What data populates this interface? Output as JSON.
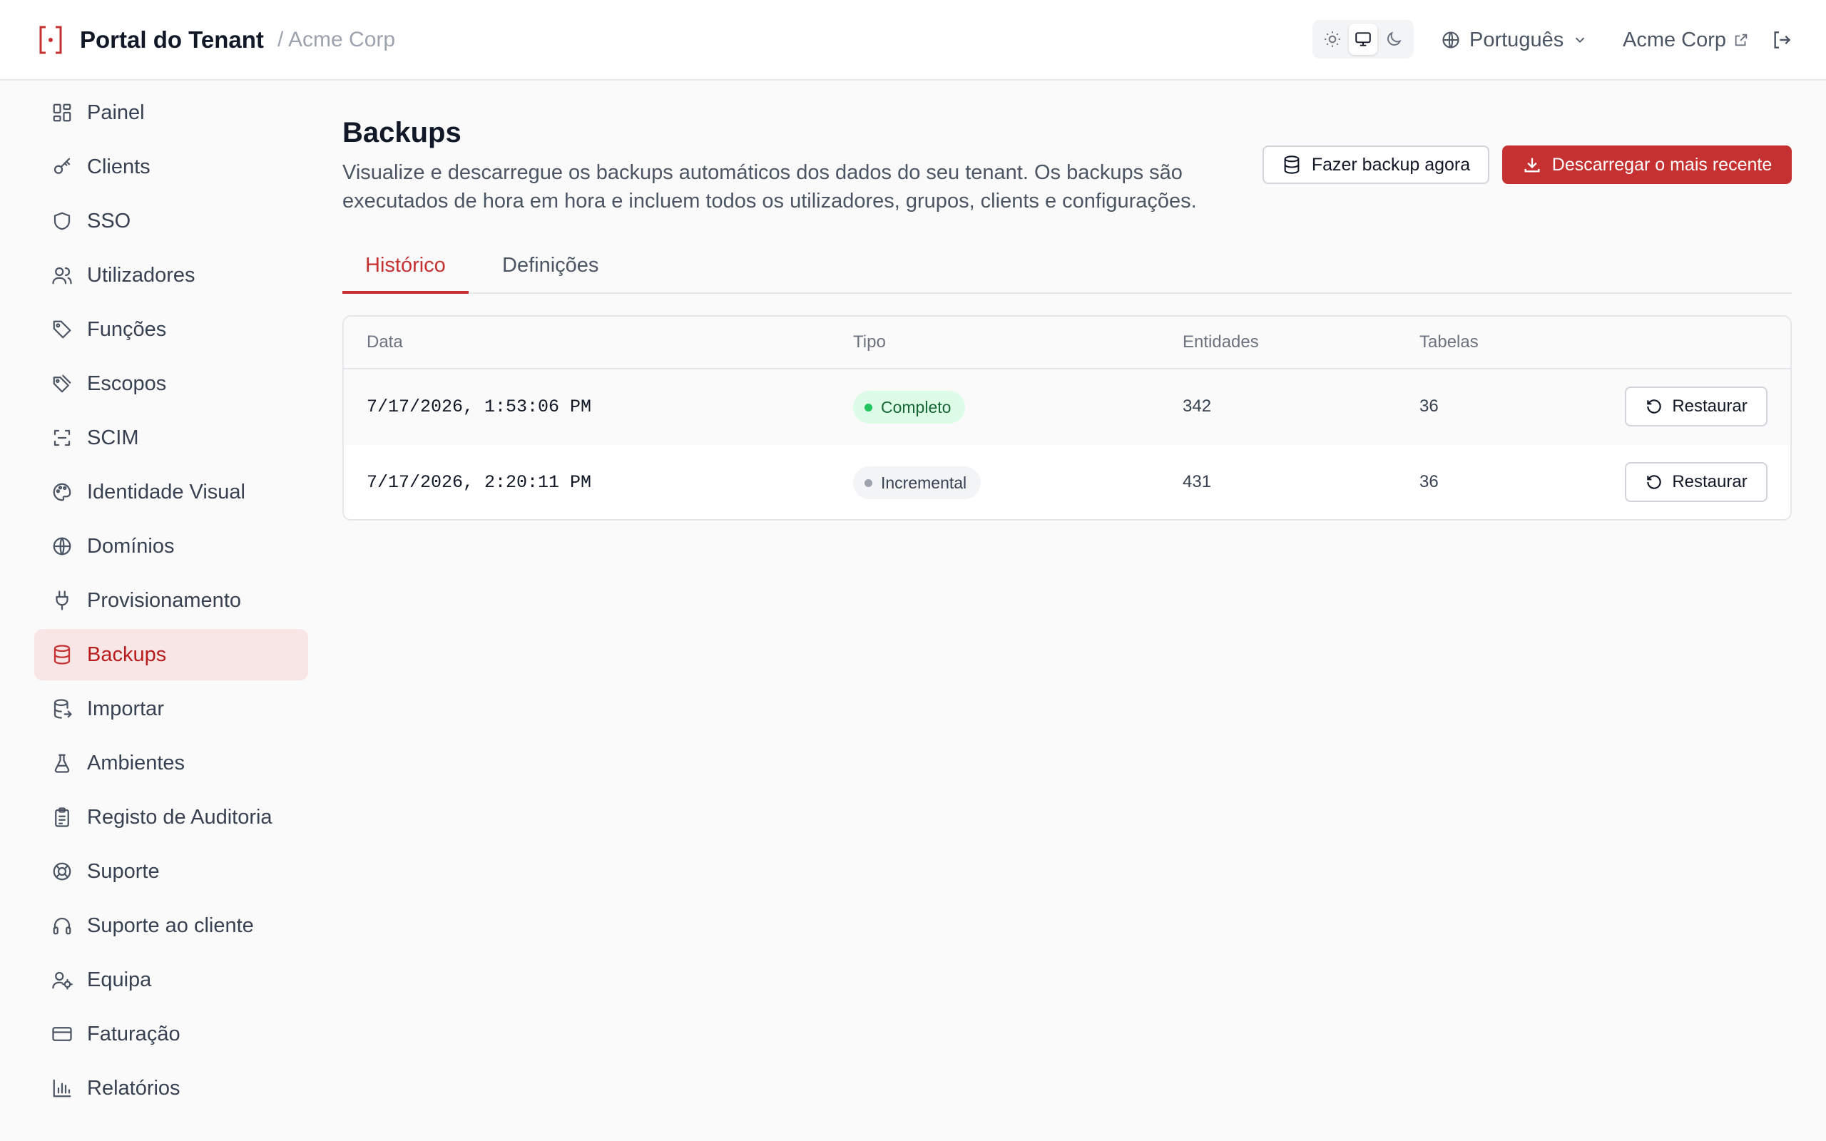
{
  "header": {
    "app_title": "Portal do Tenant",
    "breadcrumb": "/ Acme Corp",
    "theme_modes": [
      "light",
      "system",
      "dark"
    ],
    "active_theme": "system",
    "language": "Português",
    "tenant_link": "Acme Corp"
  },
  "sidebar": {
    "items": [
      {
        "label": "Painel",
        "icon": "dashboard-icon"
      },
      {
        "label": "Clients",
        "icon": "key-icon"
      },
      {
        "label": "SSO",
        "icon": "shield-icon"
      },
      {
        "label": "Utilizadores",
        "icon": "users-icon"
      },
      {
        "label": "Funções",
        "icon": "tag-icon"
      },
      {
        "label": "Escopos",
        "icon": "tags-icon"
      },
      {
        "label": "SCIM",
        "icon": "scan-icon"
      },
      {
        "label": "Identidade Visual",
        "icon": "palette-icon"
      },
      {
        "label": "Domínios",
        "icon": "globe-icon"
      },
      {
        "label": "Provisionamento",
        "icon": "plug-icon"
      },
      {
        "label": "Backups",
        "icon": "database-icon",
        "active": true
      },
      {
        "label": "Importar",
        "icon": "database-import-icon"
      },
      {
        "label": "Ambientes",
        "icon": "flask-icon"
      },
      {
        "label": "Registo de Auditoria",
        "icon": "clipboard-icon"
      },
      {
        "label": "Suporte",
        "icon": "lifebuoy-icon"
      },
      {
        "label": "Suporte ao cliente",
        "icon": "headphones-icon"
      },
      {
        "label": "Equipa",
        "icon": "user-cog-icon"
      },
      {
        "label": "Faturação",
        "icon": "credit-card-icon"
      },
      {
        "label": "Relatórios",
        "icon": "bar-chart-icon"
      }
    ]
  },
  "main": {
    "title": "Backups",
    "description": "Visualize e descarregue os backups automáticos dos dados do seu tenant. Os backups são executados de hora em hora e incluem todos os utilizadores, grupos, clients e configurações.",
    "backup_now_label": "Fazer backup agora",
    "download_latest_label": "Descarregar o mais recente",
    "tabs": [
      {
        "label": "Histórico",
        "active": true
      },
      {
        "label": "Definições",
        "active": false
      }
    ],
    "table": {
      "columns": [
        "Data",
        "Tipo",
        "Entidades",
        "Tabelas"
      ],
      "rows": [
        {
          "date": "7/17/2026, 1:53:06 PM",
          "type": "Completo",
          "type_status": "success",
          "entities": "342",
          "tables": "36",
          "action": "Restaurar"
        },
        {
          "date": "7/17/2026, 2:20:11 PM",
          "type": "Incremental",
          "type_status": "neutral",
          "entities": "431",
          "tables": "36",
          "action": "Restaurar"
        }
      ]
    }
  },
  "colors": {
    "accent": "#c53030",
    "active_bg": "#f8e5e5",
    "success_bg": "#dcfce7",
    "success_dot": "#22c55e"
  }
}
